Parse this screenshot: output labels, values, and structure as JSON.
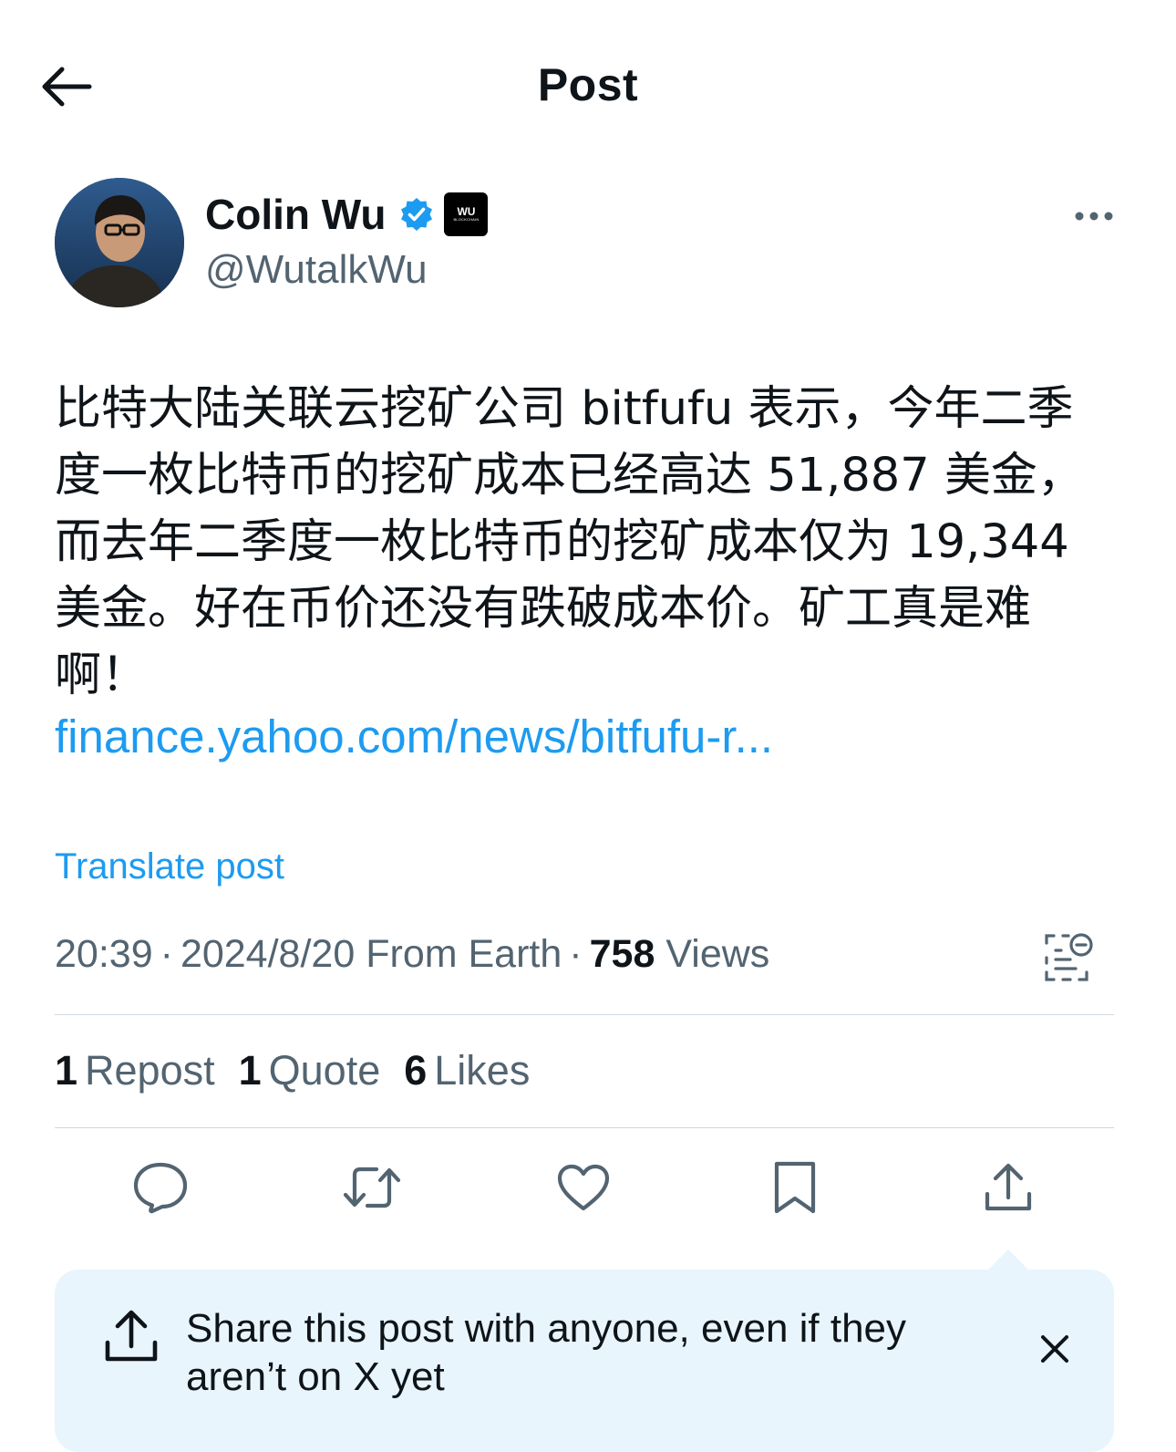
{
  "header": {
    "title": "Post",
    "back_icon": "arrow-left-icon"
  },
  "author": {
    "name": "Colin Wu",
    "handle": "@WutalkWu",
    "verified": true,
    "verified_color": "#1d9bf0",
    "affiliate_badge": {
      "title": "WU",
      "subtitle": "BLOCKCHAIN"
    }
  },
  "tweet": {
    "text": "比特大陆关联云挖矿公司 bitfufu 表示，今年二季度一枚比特币的挖矿成本已经高达 51,887 美金，而去年二季度一枚比特币的挖矿成本仅为 19,344 美金。好在币价还没有跌破成本价。矿工真是难啊！",
    "link_text": "finance.yahoo.com/news/bitfufu-r...",
    "translate_label": "Translate post"
  },
  "meta": {
    "time": "20:39",
    "separator": "·",
    "date": "2024/8/20",
    "source": "From Earth",
    "views_count": "758",
    "views_label": "Views"
  },
  "stats": {
    "reposts": {
      "count": "1",
      "label": "Repost"
    },
    "quotes": {
      "count": "1",
      "label": "Quote"
    },
    "likes": {
      "count": "6",
      "label": "Likes"
    }
  },
  "actions": [
    "reply-icon",
    "repost-icon",
    "like-icon",
    "bookmark-icon",
    "share-icon"
  ],
  "share_callout": {
    "text": "Share this post with anyone, even if they aren’t on X yet",
    "background": "#e8f5fd"
  },
  "colors": {
    "accent": "#1d9bf0",
    "text_primary": "#0f1419",
    "text_secondary": "#536471",
    "divider": "#cfd9de"
  }
}
